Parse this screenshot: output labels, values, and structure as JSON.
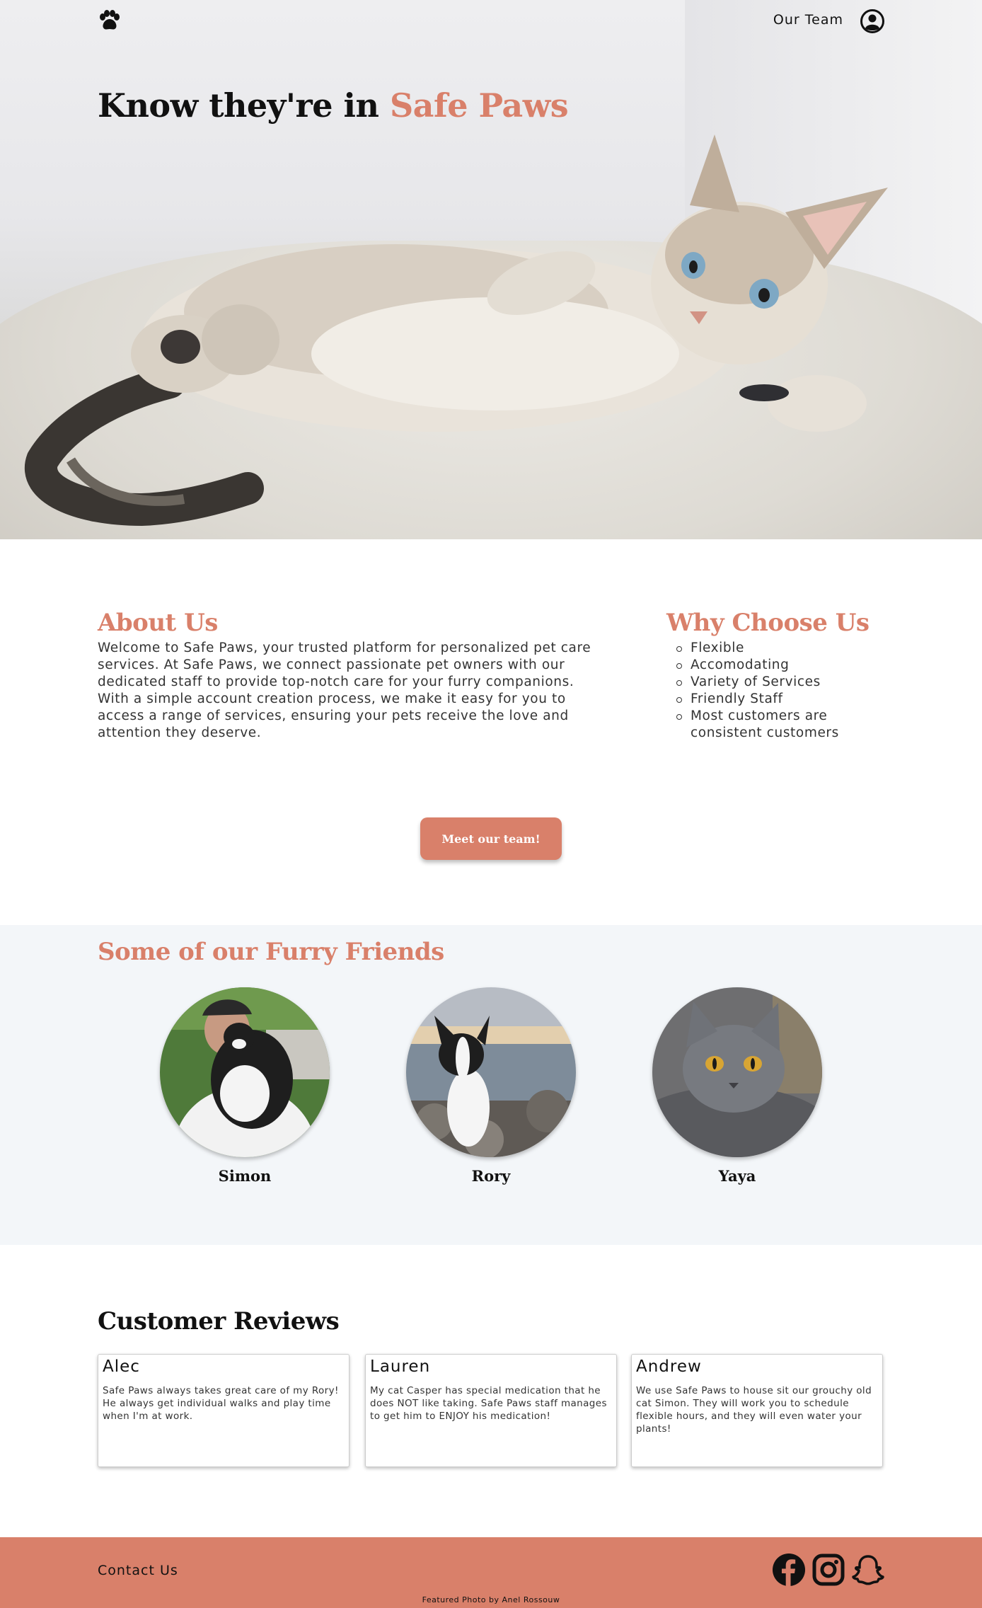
{
  "nav": {
    "team_link": "Our Team"
  },
  "hero": {
    "title_prefix": "Know they're in ",
    "title_brand": "Safe Paws"
  },
  "about": {
    "heading": "About Us",
    "text": "Welcome to Safe Paws, your trusted platform for personalized pet care services. At Safe Paws, we connect passionate pet owners with our dedicated staff to provide top-notch care for your furry companions. With a simple account creation process, we make it easy for you to access a range of services, ensuring your pets receive the love and attention they deserve."
  },
  "why": {
    "heading": "Why Choose Us",
    "items": [
      "Flexible",
      "Accomodating",
      "Variety of Services",
      "Friendly Staff",
      "Most customers are consistent customers"
    ]
  },
  "cta": {
    "label": "Meet our team!"
  },
  "friends": {
    "heading": "Some of our Furry Friends",
    "pets": [
      {
        "name": "Simon"
      },
      {
        "name": "Rory"
      },
      {
        "name": "Yaya"
      }
    ]
  },
  "reviews": {
    "heading": "Customer Reviews",
    "items": [
      {
        "name": "Alec",
        "text": "Safe Paws always takes great care of my Rory! He always get individual walks and play time when I'm at work."
      },
      {
        "name": "Lauren",
        "text": "My cat Casper has special medication that he does NOT like taking. Safe Paws staff manages to get him to ENJOY his medication!"
      },
      {
        "name": "Andrew",
        "text": "We use Safe Paws to house sit our grouchy old cat Simon. They will work you to schedule flexible hours, and they will even water your plants!"
      }
    ]
  },
  "footer": {
    "contact": "Contact Us",
    "credit": "Featured Photo by Anel Rossouw",
    "social_icons": [
      "facebook-icon",
      "instagram-icon",
      "snapchat-icon"
    ]
  },
  "colors": {
    "accent": "#d9806a",
    "friends_bg": "#f3f6f9"
  }
}
